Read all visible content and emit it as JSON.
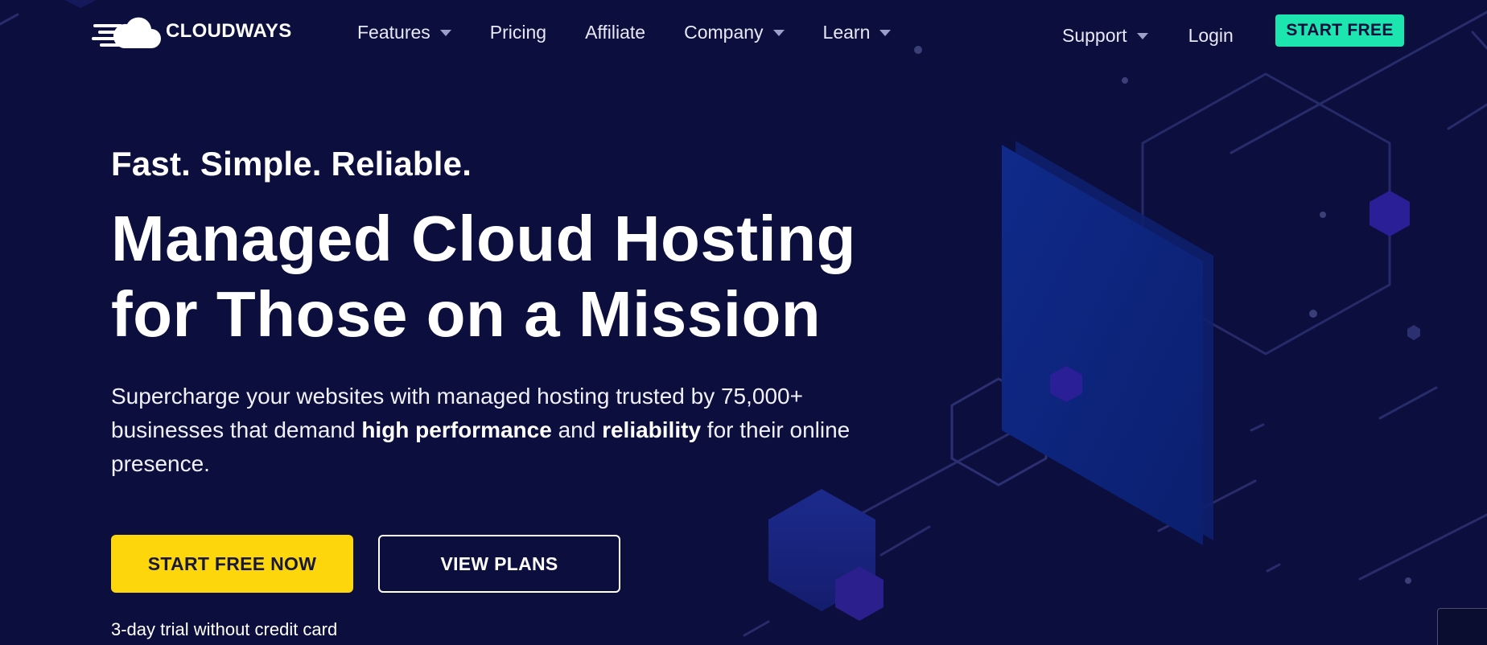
{
  "brand": {
    "name": "CLOUDWAYS",
    "logo_icon": "cloud-speed-icon"
  },
  "nav": {
    "items": [
      {
        "label": "Features",
        "has_dropdown": true
      },
      {
        "label": "Pricing",
        "has_dropdown": false
      },
      {
        "label": "Affiliate",
        "has_dropdown": false
      },
      {
        "label": "Company",
        "has_dropdown": true
      },
      {
        "label": "Learn",
        "has_dropdown": true
      }
    ],
    "support_label": "Support",
    "login_label": "Login",
    "start_free_label": "START FREE"
  },
  "hero": {
    "tagline": "Fast. Simple. Reliable.",
    "headline_line1": "Managed Cloud Hosting",
    "headline_line2": "for Those on a Mission",
    "desc_part1": "Supercharge your websites with managed hosting trusted by 75,000+ businesses that demand ",
    "desc_bold1": "high performance",
    "desc_part2": " and ",
    "desc_bold2": "reliability",
    "desc_part3": " for their online presence.",
    "primary_cta": "START FREE NOW",
    "secondary_cta": "VIEW PLANS",
    "trial_note": "3-day trial without credit card"
  },
  "colors": {
    "background": "#0c0e3d",
    "accent_green": "#1de5b0",
    "accent_yellow": "#fdd60b",
    "text": "#ffffff"
  }
}
